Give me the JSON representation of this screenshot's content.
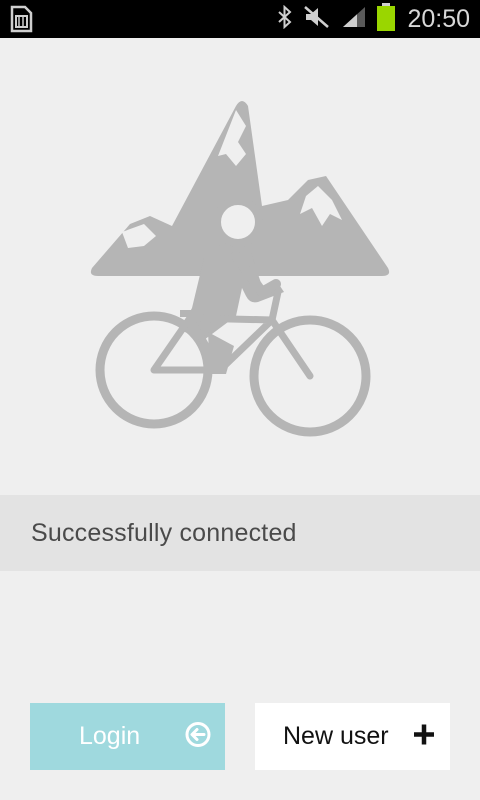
{
  "status_bar": {
    "time": "20:50",
    "icons": [
      "sim-card-icon",
      "bluetooth-icon",
      "mute-icon",
      "signal-icon",
      "battery-icon"
    ],
    "battery_color": "#9ad600"
  },
  "hero": {
    "icon": "mountain-bike-icon",
    "color": "#b5b5b5"
  },
  "status": {
    "message": "Successfully connected"
  },
  "actions": {
    "login_label": "Login",
    "login_icon": "login-arrow-icon",
    "new_user_label": "New user",
    "new_user_icon": "plus-icon"
  },
  "colors": {
    "background": "#efefef",
    "status_strip": "#e3e3e3",
    "login_button": "#9fd9de",
    "new_user_button": "#ffffff"
  }
}
